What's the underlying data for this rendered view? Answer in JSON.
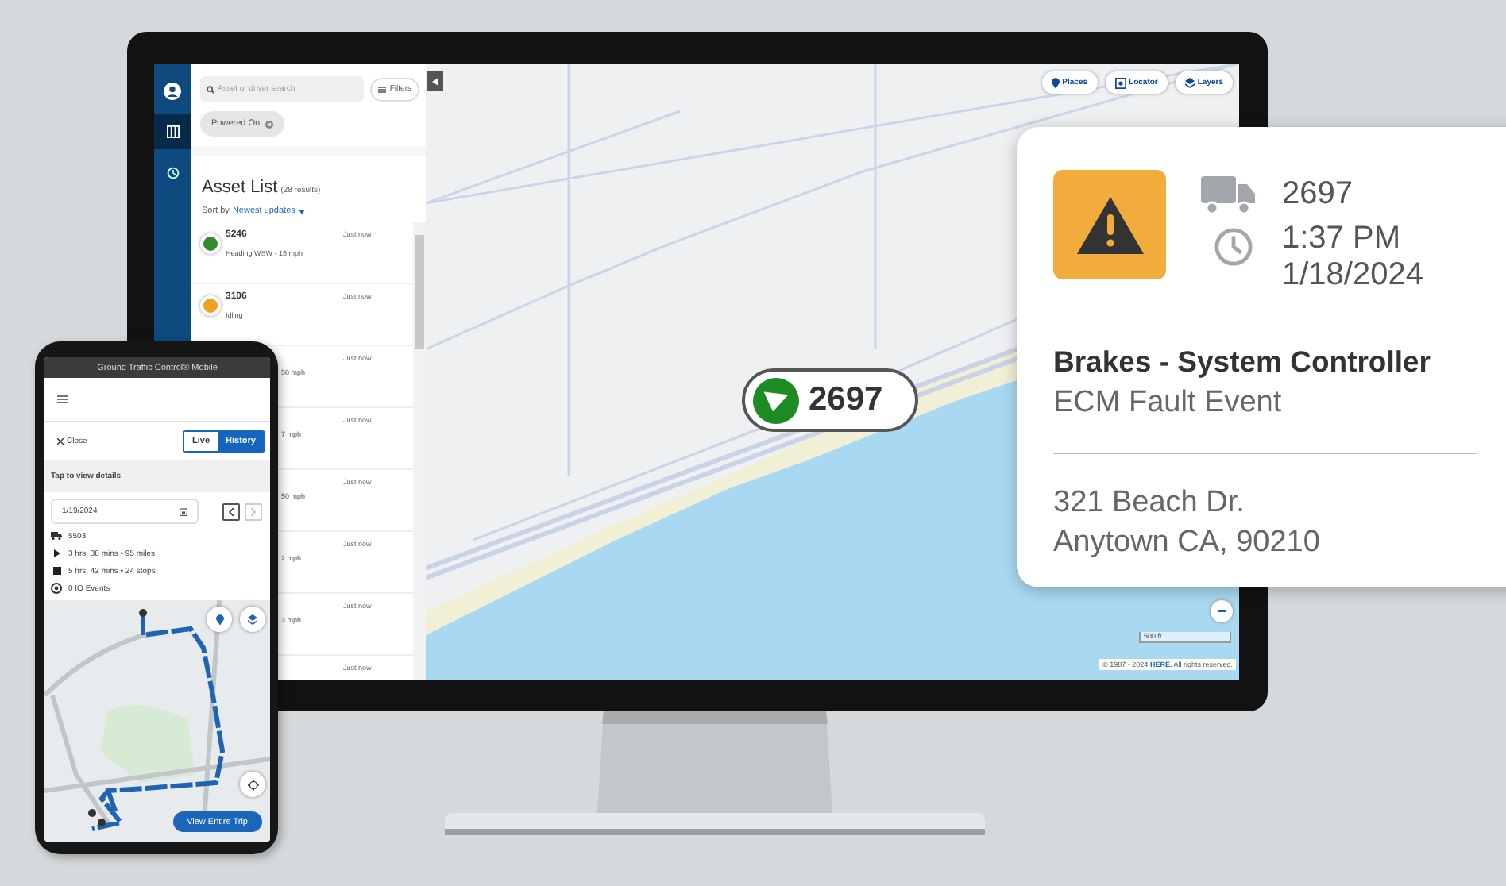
{
  "desktop": {
    "nav": [
      {
        "kind": "account",
        "selected": false
      },
      {
        "kind": "map",
        "selected": true
      },
      {
        "kind": "history",
        "selected": false
      }
    ],
    "search": {
      "placeholder": "Asset or driver search"
    },
    "filters_button": "Filters",
    "filter_chip": "Powered On",
    "asset_list": {
      "title": "Asset List",
      "count": "(28 results)",
      "sort_label": "Sort by",
      "sort_value": "Newest updates"
    },
    "assets": [
      {
        "id": "5246",
        "status": "Heading WSW - 15 mph",
        "time": "Just now",
        "color": "#2e8b2e"
      },
      {
        "id": "3106",
        "status": "Idling",
        "time": "Just now",
        "color": "#f0a020"
      },
      {
        "status": "50 mph",
        "time": "Just now"
      },
      {
        "status": "7 mph",
        "time": "Just now"
      },
      {
        "status": "50 mph",
        "time": "Just now"
      },
      {
        "status": "2 mph",
        "time": "Just now"
      },
      {
        "status": "3 mph",
        "time": "Just now"
      },
      {
        "time": "Just now"
      }
    ],
    "map": {
      "buttons": [
        {
          "kind": "places",
          "label": "Places"
        },
        {
          "kind": "locator",
          "label": "Locator"
        },
        {
          "kind": "layers",
          "label": "Layers"
        }
      ],
      "marker": "2697",
      "scale": "500 ft",
      "attribution": "© 1987 - 2024",
      "attribution_link": "HERE.",
      "attribution_rest": "All rights reserved."
    }
  },
  "popup": {
    "asset": "2697",
    "time": "1:37 PM",
    "date": "1/18/2024",
    "title": "Brakes - System Controller",
    "subtitle": "ECM Fault Event",
    "address": [
      "321 Beach Dr.",
      "Anytown CA, 90210"
    ]
  },
  "phone": {
    "app_title": "Ground Traffic Control® Mobile",
    "close": "Close",
    "modes": [
      {
        "label": "Live",
        "selected": false
      },
      {
        "label": "History",
        "selected": true
      }
    ],
    "hint": "Tap to view details",
    "date": "1/19/2024",
    "date_nav": [
      {
        "kind": "prev",
        "disabled": false
      },
      {
        "kind": "next",
        "disabled": true
      }
    ],
    "details": [
      {
        "kind": "truck",
        "text": "5503"
      },
      {
        "kind": "play",
        "text": "3 hrs, 38 mins • 95 miles"
      },
      {
        "kind": "stop",
        "text": "5 hrs, 42 mins • 24 stops"
      },
      {
        "kind": "events",
        "text": "0 IO Events"
      }
    ],
    "trip_button": "View Entire Trip"
  }
}
